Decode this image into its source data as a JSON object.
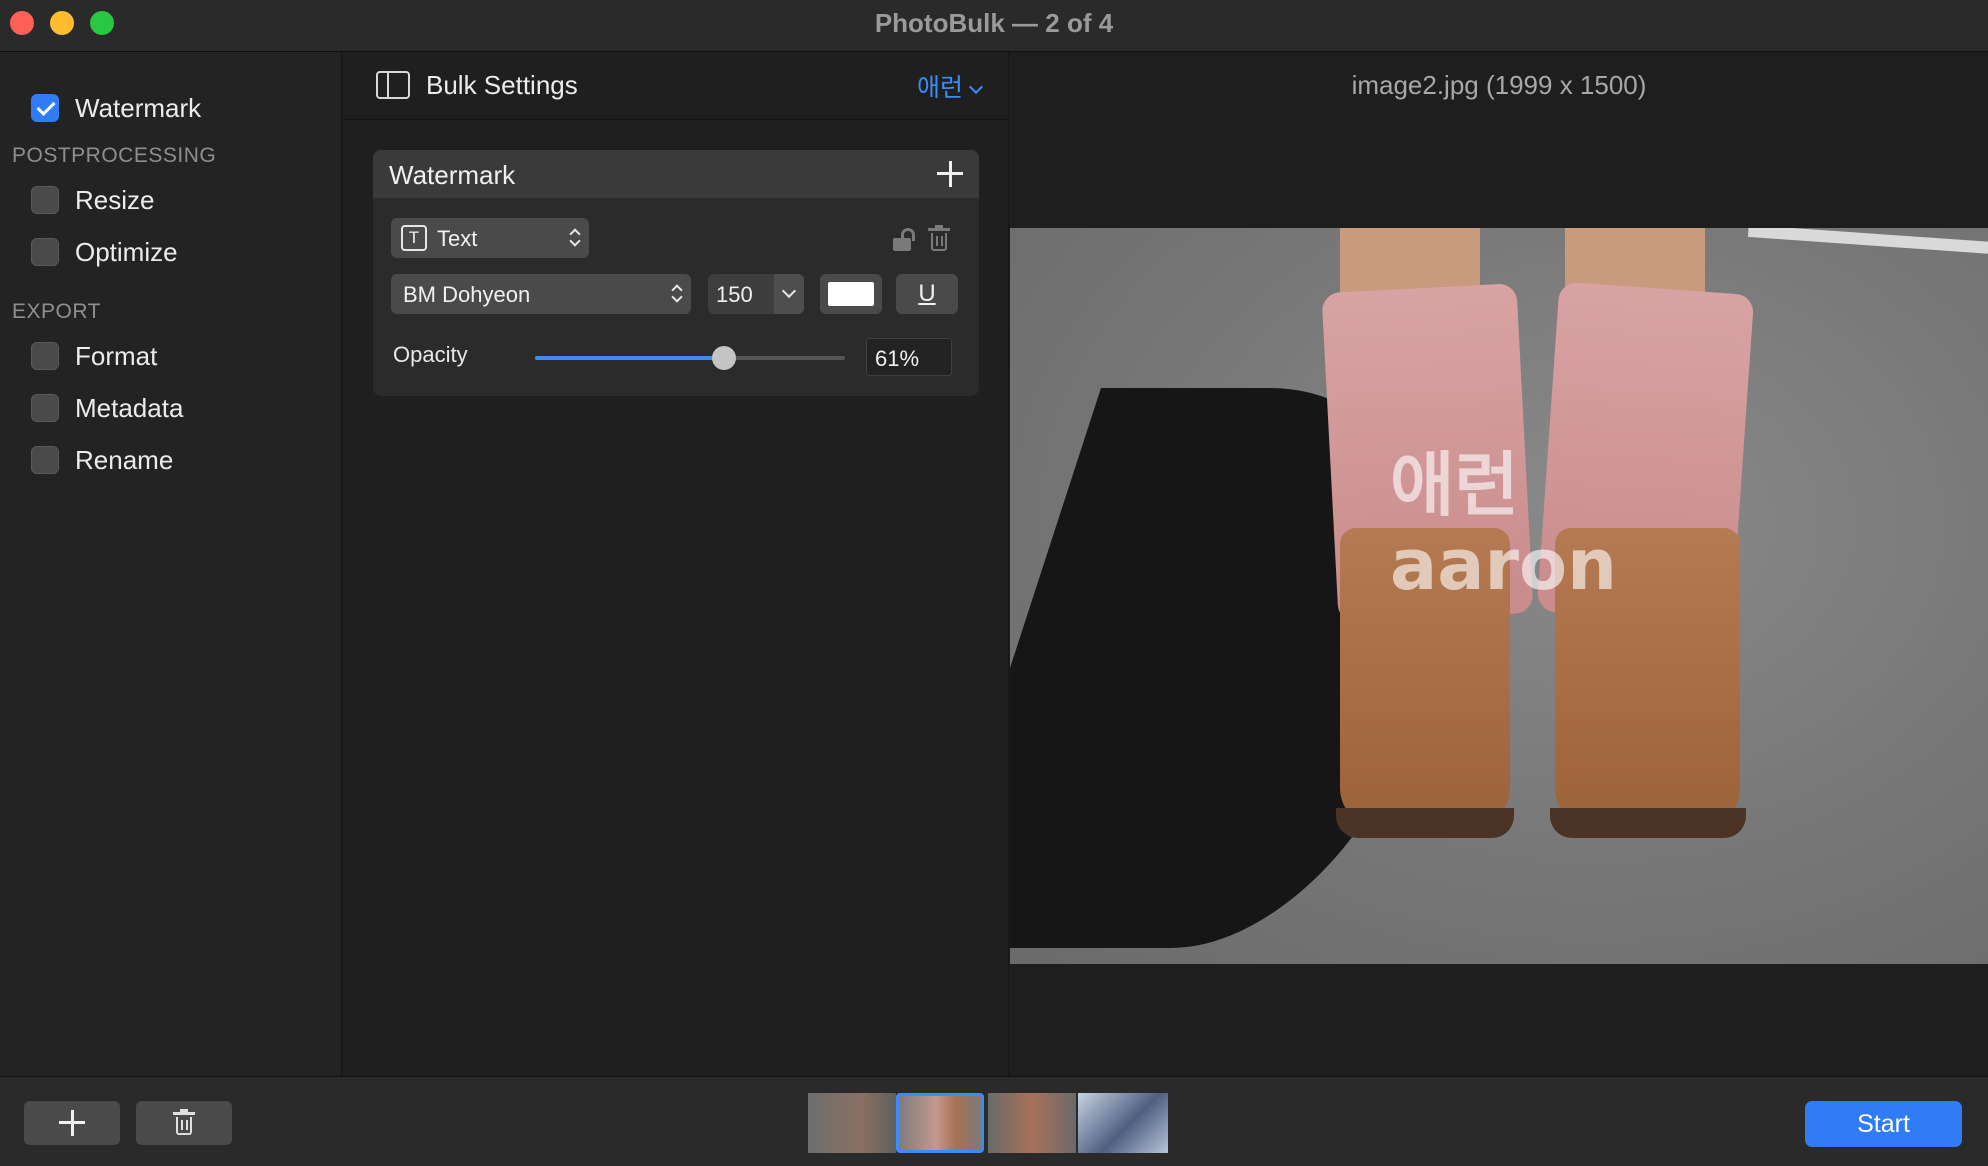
{
  "window": {
    "title": "PhotoBulk — 2 of 4"
  },
  "sidebar": {
    "watermark": {
      "label": "Watermark",
      "checked": true
    },
    "sections": [
      {
        "title": "POSTPROCESSING",
        "items": [
          {
            "label": "Resize",
            "checked": false
          },
          {
            "label": "Optimize",
            "checked": false
          }
        ]
      },
      {
        "title": "EXPORT",
        "items": [
          {
            "label": "Format",
            "checked": false
          },
          {
            "label": "Metadata",
            "checked": false
          },
          {
            "label": "Rename",
            "checked": false
          }
        ]
      }
    ]
  },
  "settings": {
    "title": "Bulk Settings",
    "preset": "애런",
    "watermark_card": {
      "title": "Watermark",
      "type": "Text",
      "font": "BM Dohyeon",
      "size": "150",
      "color": "#ffffff",
      "underline_glyph": "U",
      "opacity_label": "Opacity",
      "opacity_percent": 61,
      "opacity_text": "61%"
    }
  },
  "preview": {
    "caption": "image2.jpg (1999 x 1500)",
    "watermark_lines": [
      "애런",
      "aaron"
    ]
  },
  "bottombar": {
    "start_label": "Start",
    "selected_thumbnail": 2,
    "thumbnail_count": 4
  },
  "icons": {
    "close": "red-circle",
    "minimize": "yellow-circle",
    "maximize": "green-circle",
    "panel": "sidebar-panel-icon",
    "add": "plus-icon",
    "lock": "unlocked-lock-icon",
    "delete": "trash-icon",
    "text_type": "t-box-icon"
  },
  "colors": {
    "accent": "#2f7cf6",
    "link": "#3c8cf8"
  }
}
